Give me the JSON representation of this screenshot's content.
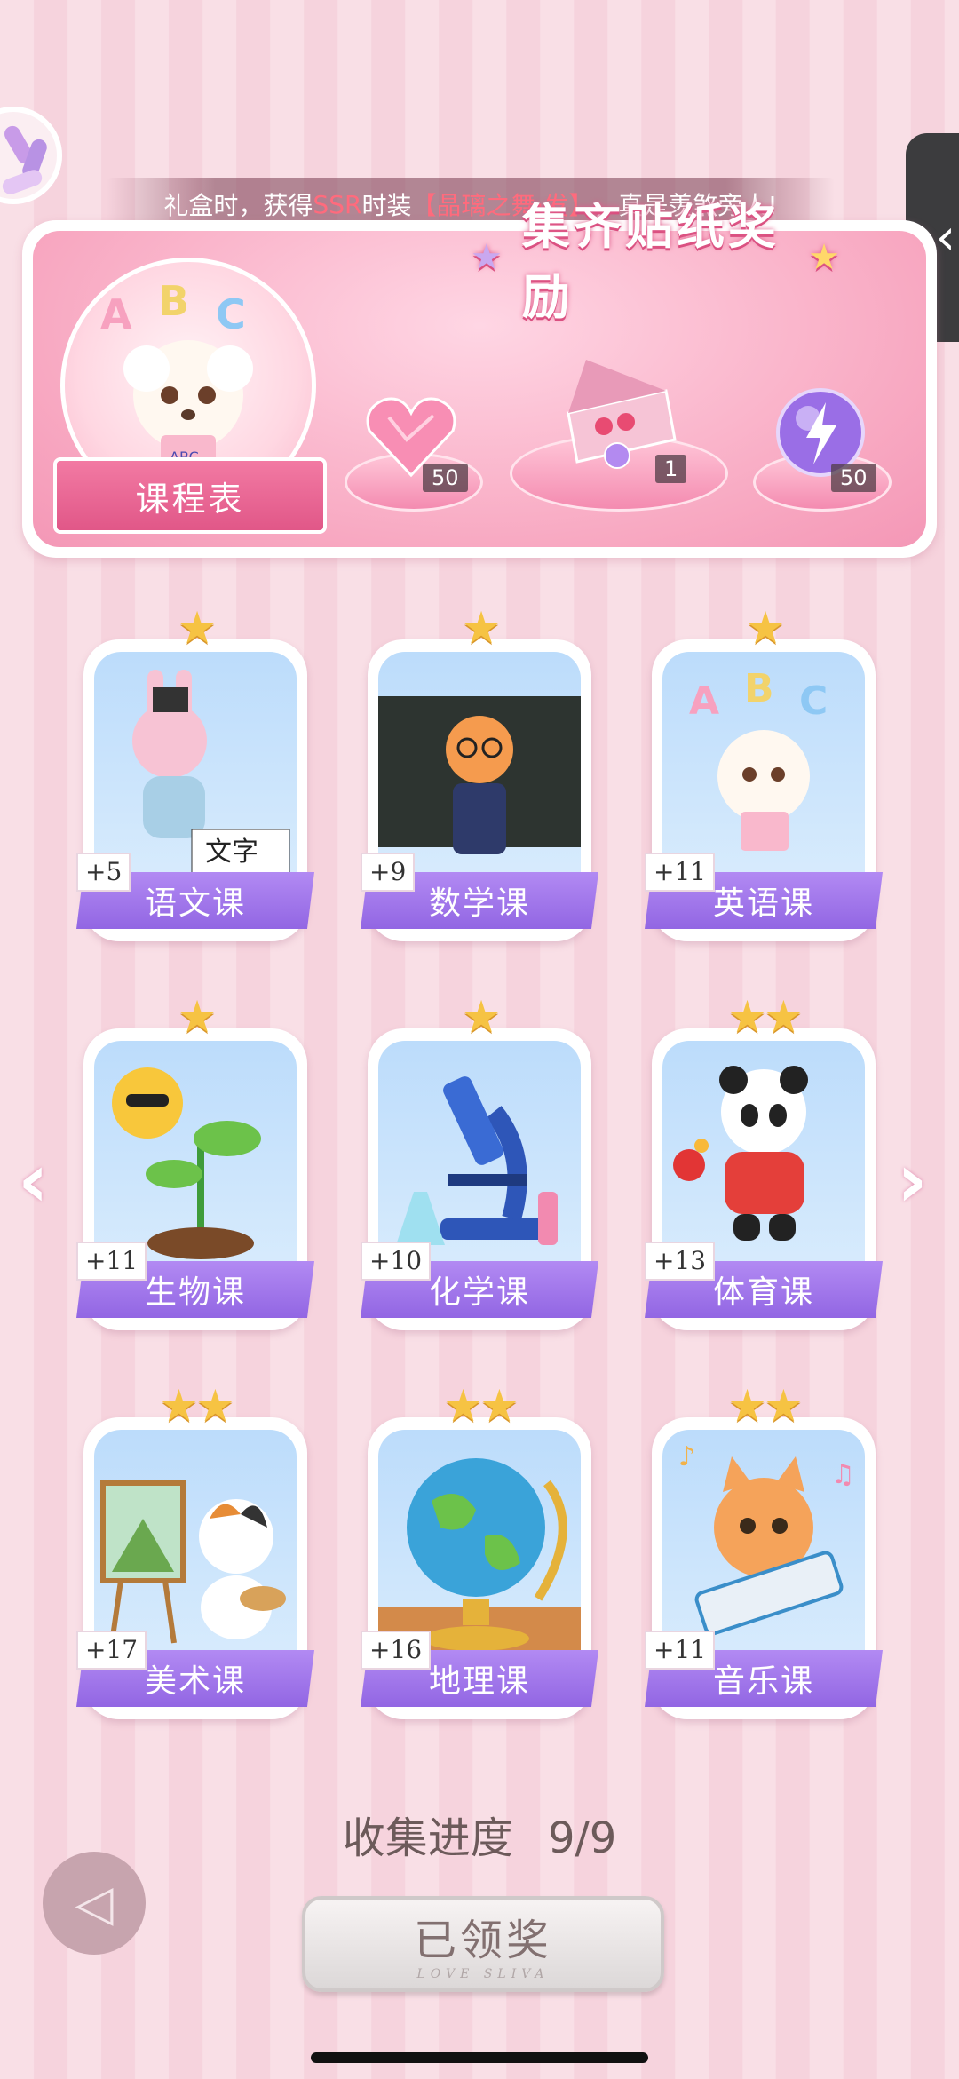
{
  "marquee": {
    "prefix": "礼盒时，获得",
    "highlight1": "SSR",
    "mid": "时装",
    "highlight2": "【晶璃之舞·发】",
    "suffix": "，真是羡煞旁人!"
  },
  "banner": {
    "title": "集齐贴纸奖励",
    "course_button": "课程表",
    "rewards": [
      {
        "icon": "pink-heart-gem-icon",
        "count": "50"
      },
      {
        "icon": "gift-box-icon",
        "count": "1"
      },
      {
        "icon": "purple-lightning-orb-icon",
        "count": "50"
      }
    ]
  },
  "cards": [
    {
      "label": "语文课",
      "bonus": "+5",
      "stars": "★",
      "art": "bunny-calligraphy-art"
    },
    {
      "label": "数学课",
      "bonus": "+9",
      "stars": "★",
      "art": "fox-teacher-art"
    },
    {
      "label": "英语课",
      "bonus": "+11",
      "stars": "★",
      "art": "poodle-abc-art"
    },
    {
      "label": "生物课",
      "bonus": "+11",
      "stars": "★",
      "art": "sun-sprout-art"
    },
    {
      "label": "化学课",
      "bonus": "+10",
      "stars": "★",
      "art": "microscope-art"
    },
    {
      "label": "体育课",
      "bonus": "+13",
      "stars": "★★",
      "art": "panda-pingpong-art"
    },
    {
      "label": "美术课",
      "bonus": "+17",
      "stars": "★★",
      "art": "cat-painter-art"
    },
    {
      "label": "地理课",
      "bonus": "+16",
      "stars": "★★",
      "art": "globe-art"
    },
    {
      "label": "音乐课",
      "bonus": "+11",
      "stars": "★★",
      "art": "cat-keyboard-art"
    }
  ],
  "progress": {
    "label": "收集进度",
    "value": "9/9"
  },
  "claim_button": {
    "label": "已领奖",
    "subtitle": "LOVE SLIVA"
  },
  "colors": {
    "accent": "#f27aa3",
    "card_label": "#9c72ea",
    "star": "#f6c343"
  }
}
